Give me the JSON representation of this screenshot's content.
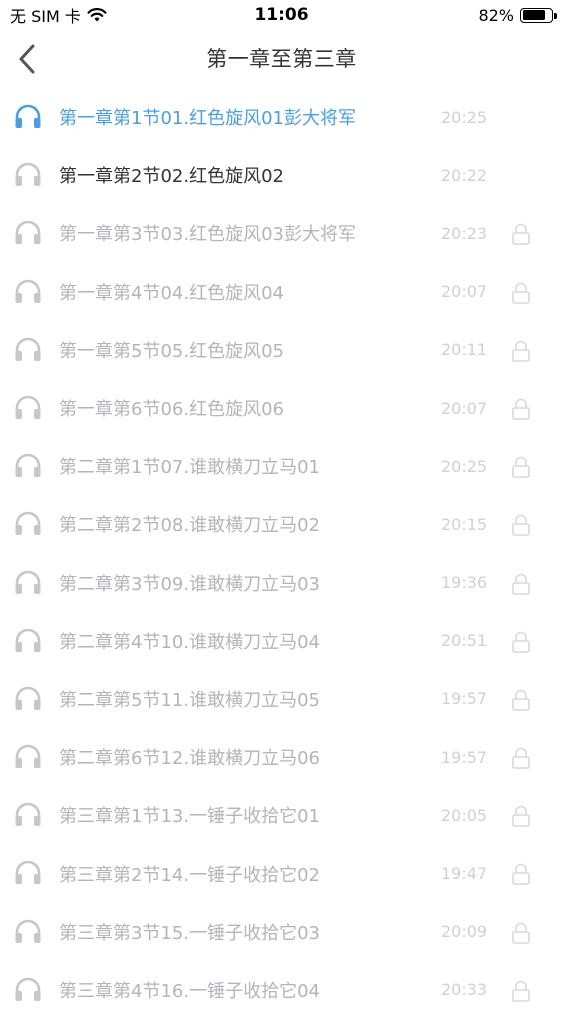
{
  "status_bar": {
    "carrier": "无 SIM 卡",
    "time": "11:06",
    "battery": "82%",
    "battery_level": 0.82
  },
  "nav": {
    "title": "第一章至第三章"
  },
  "colors": {
    "playing": "#4a9fe0",
    "unlocked": "#333333",
    "locked": "#b4b4bc",
    "time": "#d0d0d6",
    "icon": "#c6c6cc"
  },
  "tracks": [
    {
      "title": "第一章第1节01.红色旋风01彭大将军",
      "duration": "20:25",
      "state": "playing",
      "locked": false
    },
    {
      "title": "第一章第2节02.红色旋风02",
      "duration": "20:22",
      "state": "unlocked",
      "locked": false
    },
    {
      "title": "第一章第3节03.红色旋风03彭大将军",
      "duration": "20:23",
      "state": "locked",
      "locked": true
    },
    {
      "title": "第一章第4节04.红色旋风04",
      "duration": "20:07",
      "state": "locked",
      "locked": true
    },
    {
      "title": "第一章第5节05.红色旋风05",
      "duration": "20:11",
      "state": "locked",
      "locked": true
    },
    {
      "title": "第一章第6节06.红色旋风06",
      "duration": "20:07",
      "state": "locked",
      "locked": true
    },
    {
      "title": "第二章第1节07.谁敢横刀立马01",
      "duration": "20:25",
      "state": "locked",
      "locked": true
    },
    {
      "title": "第二章第2节08.谁敢横刀立马02",
      "duration": "20:15",
      "state": "locked",
      "locked": true
    },
    {
      "title": "第二章第3节09.谁敢横刀立马03",
      "duration": "19:36",
      "state": "locked",
      "locked": true
    },
    {
      "title": "第二章第4节10.谁敢横刀立马04",
      "duration": "20:51",
      "state": "locked",
      "locked": true
    },
    {
      "title": "第二章第5节11.谁敢横刀立马05",
      "duration": "19:57",
      "state": "locked",
      "locked": true
    },
    {
      "title": "第二章第6节12.谁敢横刀立马06",
      "duration": "19:57",
      "state": "locked",
      "locked": true
    },
    {
      "title": "第三章第1节13.一锤子收拾它01",
      "duration": "20:05",
      "state": "locked",
      "locked": true
    },
    {
      "title": "第三章第2节14.一锤子收拾它02",
      "duration": "19:47",
      "state": "locked",
      "locked": true
    },
    {
      "title": "第三章第3节15.一锤子收拾它03",
      "duration": "20:09",
      "state": "locked",
      "locked": true
    },
    {
      "title": "第三章第4节16.一锤子收拾它04",
      "duration": "20:33",
      "state": "locked",
      "locked": true
    }
  ]
}
